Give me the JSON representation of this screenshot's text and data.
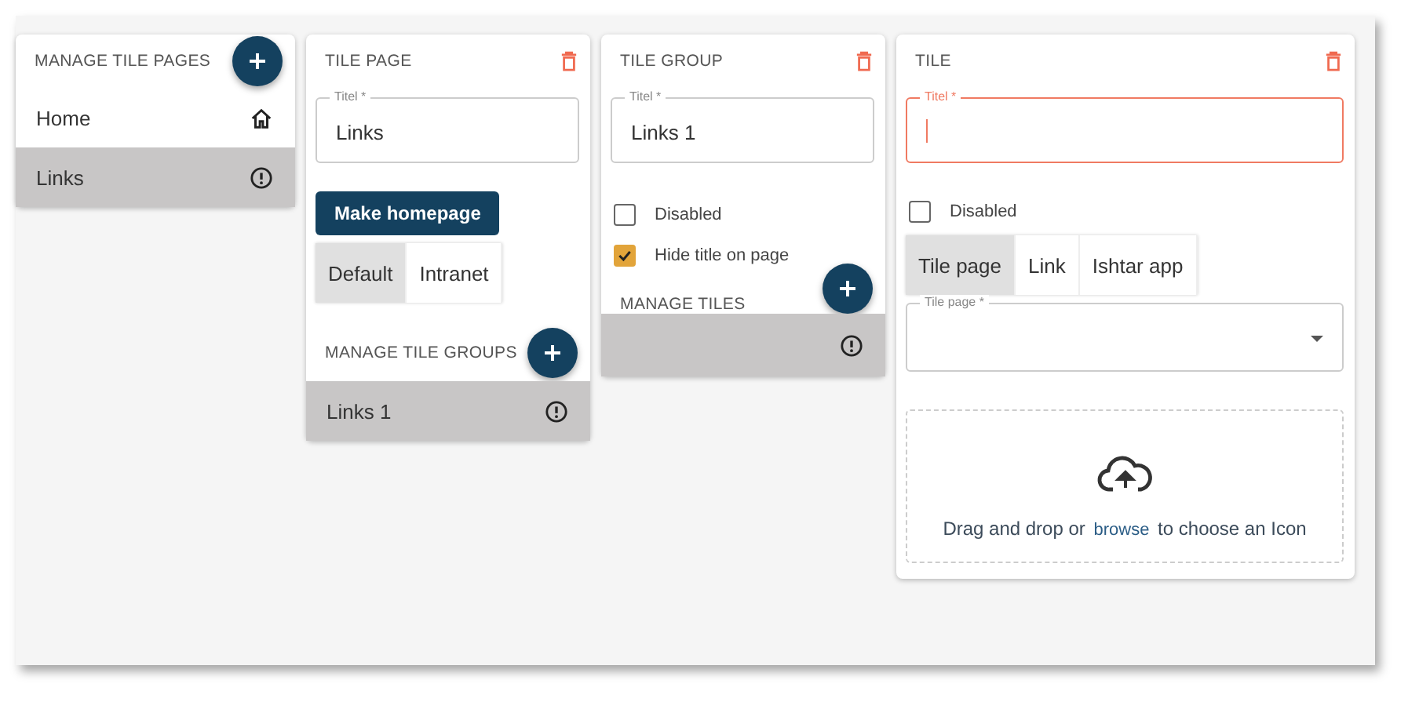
{
  "pages_panel": {
    "title": "MANAGE TILE PAGES",
    "items": [
      {
        "label": "Home",
        "kind": "home",
        "selected": false
      },
      {
        "label": "Links",
        "kind": "alert",
        "selected": true
      }
    ]
  },
  "tile_page_panel": {
    "title": "TILE PAGE",
    "title_field": {
      "label": "Titel *",
      "value": "Links"
    },
    "make_homepage_button": "Make homepage",
    "layout_options": [
      {
        "label": "Default",
        "selected": true
      },
      {
        "label": "Intranet",
        "selected": false
      }
    ],
    "groups_title": "MANAGE TILE GROUPS",
    "groups": [
      {
        "label": "Links 1",
        "kind": "alert",
        "selected": true
      }
    ]
  },
  "tile_group_panel": {
    "title": "TILE GROUP",
    "title_field": {
      "label": "Titel *",
      "value": "Links 1"
    },
    "checkboxes": [
      {
        "label": "Disabled",
        "checked": false
      },
      {
        "label": "Hide title on page",
        "checked": true
      }
    ],
    "tiles_title": "MANAGE TILES",
    "tiles": [
      {
        "kind": "alert",
        "selected": true
      }
    ]
  },
  "tile_panel": {
    "title": "TILE",
    "title_field": {
      "label": "Titel *",
      "focused": true
    },
    "checkboxes": [
      {
        "label": "Disabled",
        "checked": false
      }
    ],
    "type_options": [
      {
        "label": "Tile page",
        "selected": true
      },
      {
        "label": "Link",
        "selected": false
      },
      {
        "label": "Ishtar app",
        "selected": false
      }
    ],
    "tile_page_select": {
      "label": "Tile page *"
    },
    "dropzone": {
      "before": "Drag and drop or",
      "link": "browse",
      "after": "to choose an Icon"
    }
  }
}
